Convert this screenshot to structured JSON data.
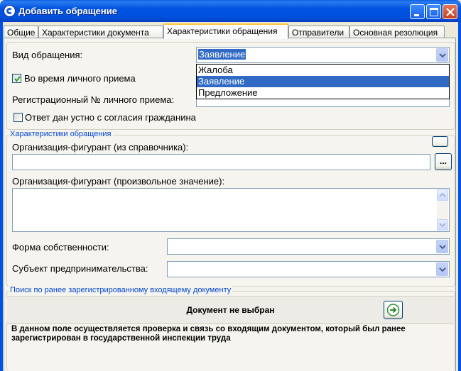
{
  "window": {
    "title": "Добавить обращение"
  },
  "tabs": [
    {
      "label": "Общие"
    },
    {
      "label": "Характеристики документа"
    },
    {
      "label": "Характеристики обращения"
    },
    {
      "label": "Отправители"
    },
    {
      "label": "Основная резолюция"
    }
  ],
  "form": {
    "type_label": "Вид обращения:",
    "type_value": "Заявление",
    "type_options": [
      "Жалоба",
      "Заявление",
      "Предложение"
    ],
    "personal_reception_label": "Во время личного приема",
    "personal_reception_checked": true,
    "reg_number_label": "Регистрационный № личного приема:",
    "oral_answer_label": "Ответ дан устно с согласия гражданина",
    "oral_answer_checked": false
  },
  "characteristics": {
    "legend": "Характеристики обращения",
    "org_ref_label": "Организация-фигурант (из справочника):",
    "org_ref_browse": "...",
    "org_free_label": "Организация-фигурант (произвольное значение):",
    "ownership_label": "Форма собственности:",
    "business_label": "Субъект предпринимательства:"
  },
  "search": {
    "legend": "Поиск по ранее зарегистрированному входящему документу",
    "status": "Документ не выбран",
    "description": "В данном поле осуществляется проверка и связь со входящим документом, который был ранее зарегистрирован в государственной инспекции труда"
  },
  "colors": {
    "accent": "#316ac5",
    "legend": "#0046d5",
    "title_bar": "#0053e1"
  }
}
